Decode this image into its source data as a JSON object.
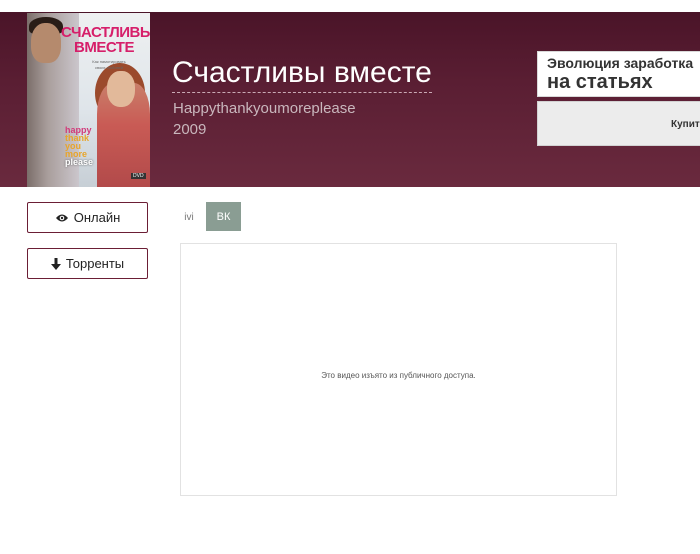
{
  "movie": {
    "title": "Счастливы вместе",
    "original_title": "Happythankyoumoreplease",
    "year": "2009"
  },
  "poster": {
    "title": "СЧАСТЛИВЫ ВМЕСТЕ",
    "tagline_small": "Как намотировать своих любовей",
    "slogan": [
      "happy",
      "thank you",
      "more",
      "please"
    ],
    "badge": "DVD"
  },
  "ad": {
    "line1": "Эволюция заработка",
    "line2": "на статьях",
    "buy_label": "Купить"
  },
  "sidebar": {
    "online_label": "Онлайн",
    "torrents_label": "Торренты"
  },
  "player": {
    "tabs": [
      {
        "label": "ivi",
        "active": false
      },
      {
        "label": "ВК",
        "active": true
      }
    ],
    "message": "Это видео изъято из публичного доступа."
  },
  "colors": {
    "hero_bg": "#5a1e33",
    "active_tab": "#8a9d93",
    "button_border": "#6b1e35"
  },
  "icons": {
    "online": "eye-icon",
    "torrents": "arrow-down-icon"
  }
}
